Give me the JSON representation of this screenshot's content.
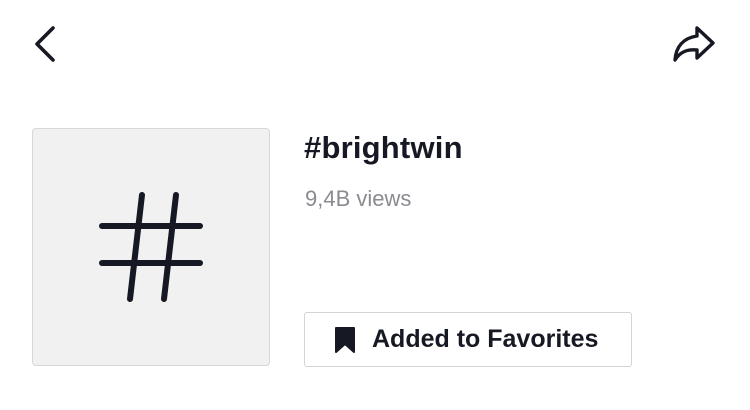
{
  "header": {
    "back_icon": "chevron-left-icon",
    "share_icon": "share-arrow-icon"
  },
  "hashtag": {
    "thumbnail_icon": "hash-icon",
    "title": "#brightwin",
    "views": "9,4B views"
  },
  "favorite": {
    "icon": "bookmark-icon",
    "label": "Added to Favorites"
  },
  "colors": {
    "text_primary": "#161823",
    "text_secondary": "#8a8b91",
    "thumbnail_bg": "#f1f1f2",
    "border": "#d4d4d7"
  }
}
